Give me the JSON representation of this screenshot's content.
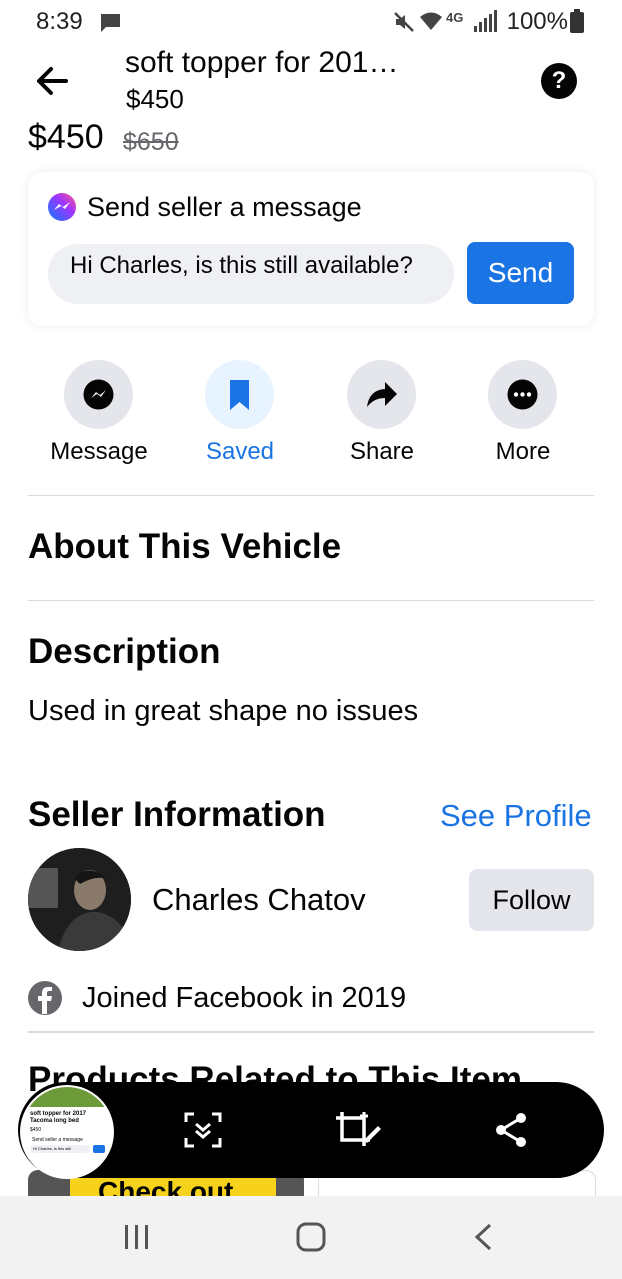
{
  "status_bar": {
    "time": "8:39",
    "network": "4G",
    "battery": "100%"
  },
  "header": {
    "back_icon": "arrow-left-icon",
    "title": "soft topper for 201…",
    "price": "$450",
    "help_icon": "question-icon"
  },
  "listing": {
    "price": "$450",
    "original_price": "$650"
  },
  "message_card": {
    "title": "Send seller a message",
    "input_value": "Hi Charles, is this still available?",
    "send_label": "Send"
  },
  "actions": [
    {
      "label": "Message",
      "icon": "messenger-icon"
    },
    {
      "label": "Saved",
      "icon": "bookmark-icon"
    },
    {
      "label": "Share",
      "icon": "share-arrow-icon"
    },
    {
      "label": "More",
      "icon": "more-icon"
    }
  ],
  "sections": {
    "about": "About This Vehicle",
    "description_title": "Description",
    "description_text": "Used in great shape no issues",
    "seller_title": "Seller Information",
    "see_profile": "See Profile",
    "seller_name": "Charles Chatov",
    "follow_label": "Follow",
    "joined": "Joined Facebook in 2019",
    "related_title": "Products Related to This Item",
    "related_partial_text": "Check out"
  },
  "screenshot_toolbar": {
    "thumbnail_title": "soft topper for 2017 Tacoma long bed",
    "thumbnail_price": "$450",
    "thumbnail_card": "Send seller a message",
    "thumbnail_input": "Hi Charles, is this still",
    "tools": [
      "scroll-capture-icon",
      "crop-edit-icon",
      "share-icon"
    ]
  },
  "colors": {
    "accent": "#1b74e4",
    "text": "#050505",
    "muted": "#65676b",
    "chip_bg": "#e4e6eb"
  }
}
